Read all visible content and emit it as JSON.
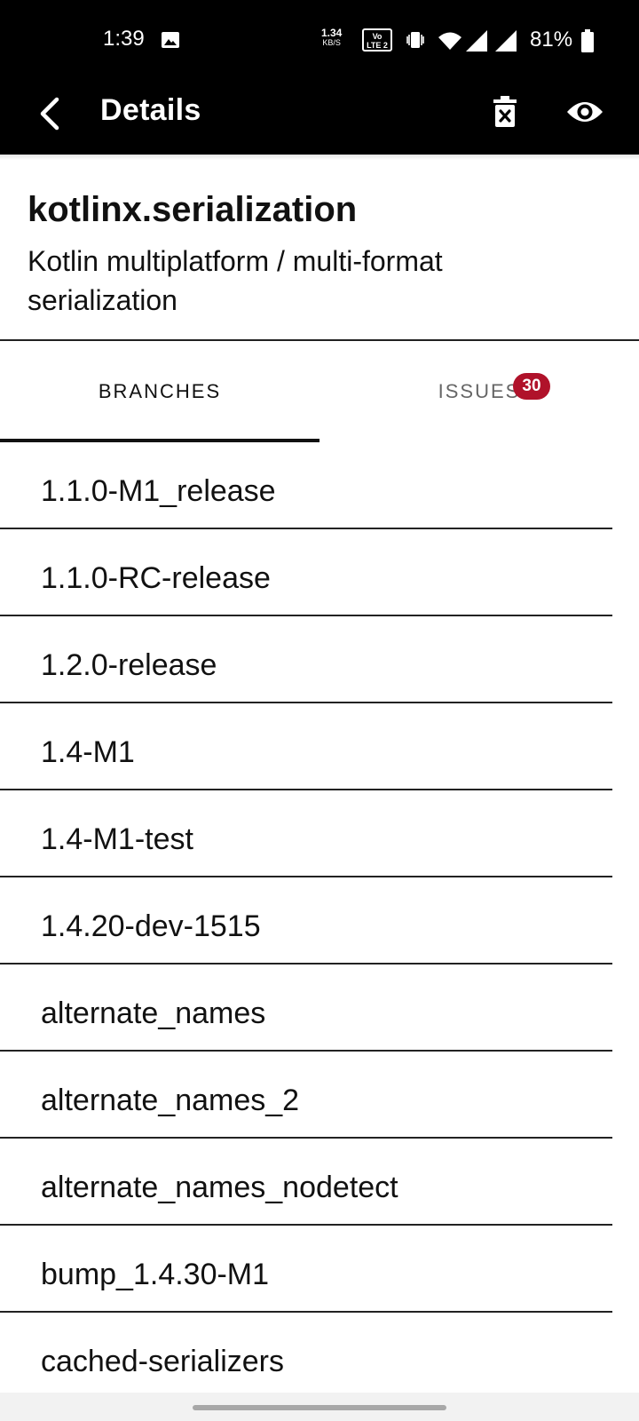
{
  "status_bar": {
    "time": "1:39",
    "net_speed_value": "1.34",
    "net_speed_unit": "KB/S",
    "volte_line1": "Vo",
    "volte_line2": "LTE 2",
    "battery_percent": "81%",
    "icons": [
      "gallery-icon",
      "volte-icon",
      "vibrate-icon",
      "wifi-icon",
      "signal-icon",
      "signal-icon",
      "battery-icon"
    ]
  },
  "app_bar": {
    "title": "Details",
    "icons": [
      "back-arrow-icon",
      "delete-icon",
      "eye-icon"
    ]
  },
  "repo": {
    "name": "kotlinx.serialization",
    "description": "Kotlin multiplatform / multi-format serialization"
  },
  "tabs": {
    "branches_label": "BRANCHES",
    "issues_label": "ISSUES",
    "issues_badge": "30",
    "active": "BRANCHES",
    "badge_color": "#b0122a"
  },
  "branches": [
    "1.1.0-M1_release",
    "1.1.0-RC-release",
    "1.2.0-release",
    "1.4-M1",
    "1.4-M1-test",
    "1.4.20-dev-1515",
    "alternate_names",
    "alternate_names_2",
    "alternate_names_nodetect",
    "bump_1.4.30-M1",
    "cached-serializers"
  ]
}
